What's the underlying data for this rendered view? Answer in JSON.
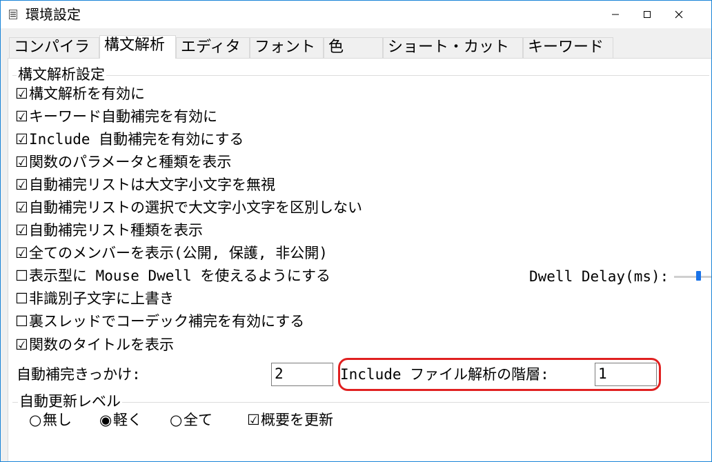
{
  "window": {
    "title": "環境設定"
  },
  "tabs": [
    {
      "label": "コンパイラ"
    },
    {
      "label": "構文解析"
    },
    {
      "label": "エディタ"
    },
    {
      "label": "フォント"
    },
    {
      "label": "色"
    },
    {
      "label": "ショート・カット"
    },
    {
      "label": "キーワード"
    }
  ],
  "active_tab": "構文解析",
  "group_parse": {
    "title": "構文解析設定",
    "options": [
      {
        "label": "構文解析を有効に",
        "checked": true
      },
      {
        "label": "キーワード自動補完を有効に",
        "checked": true
      },
      {
        "label": "Include 自動補完を有効にする",
        "checked": true
      },
      {
        "label": "関数のパラメータと種類を表示",
        "checked": true
      },
      {
        "label": "自動補完リストは大文字小文字を無視",
        "checked": true
      },
      {
        "label": "自動補完リストの選択で大文字小文字を区別しない",
        "checked": true
      },
      {
        "label": "自動補完リスト種類を表示",
        "checked": true
      },
      {
        "label": "全てのメンバーを表示(公開, 保護, 非公開)",
        "checked": true
      },
      {
        "label": "表示型に Mouse Dwell を使えるようにする",
        "checked": false
      },
      {
        "label": "非識別子文字に上書き",
        "checked": false
      },
      {
        "label": "裏スレッドでコーデック補完を有効にする",
        "checked": false
      },
      {
        "label": "関数のタイトルを表示",
        "checked": true
      }
    ],
    "dwell_delay_label": "Dwell Delay(ms):",
    "trigger_label": "自動補完きっかけ:",
    "trigger_value": "2",
    "include_depth_label": "Include ファイル解析の階層:",
    "include_depth_value": "1",
    "highlight_color": "#e02020"
  },
  "group_update": {
    "title": "自動更新レベル",
    "radios": [
      {
        "label": "無し",
        "selected": false
      },
      {
        "label": "軽く",
        "selected": true
      },
      {
        "label": "全て",
        "selected": false
      }
    ],
    "summary_label": "概要を更新",
    "summary_checked": true
  },
  "symbols": {
    "checked": "☑",
    "unchecked": "☐",
    "radio_on": "◉",
    "radio_off": "○"
  },
  "colors": {
    "window_border": "#1883d7",
    "slider_thumb": "#1a73e8"
  }
}
